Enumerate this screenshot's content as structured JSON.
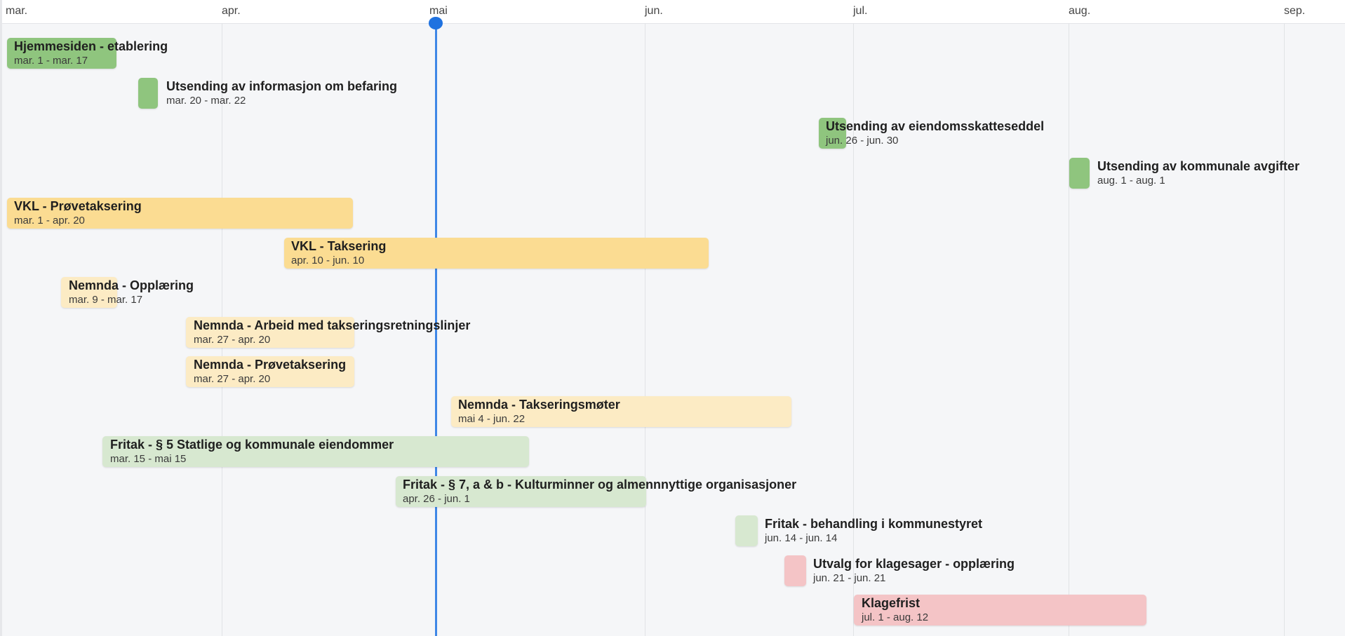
{
  "timeline": {
    "months": [
      "mar.",
      "apr.",
      "mai",
      "jun.",
      "jul.",
      "aug.",
      "sep."
    ],
    "today_marker_month": "mai",
    "tasks": [
      {
        "title": "Hjemmesiden - etablering",
        "dates": "mar. 1 - mar. 17",
        "color": "#8fc57e"
      },
      {
        "title": "Utsending av informasjon om befaring",
        "dates": "mar. 20 - mar. 22",
        "color": "#8fc57e"
      },
      {
        "title": "Utsending av eiendomsskatteseddel",
        "dates": "jun. 26 - jun. 30",
        "color": "#8fc57e"
      },
      {
        "title": "Utsending av kommunale avgifter",
        "dates": "aug. 1 - aug. 1",
        "color": "#8fc57e"
      },
      {
        "title": "VKL - Prøvetaksering",
        "dates": "mar. 1 - apr. 20",
        "color": "#fbdc92"
      },
      {
        "title": "VKL - Taksering",
        "dates": "apr. 10 - jun. 10",
        "color": "#fbdc92"
      },
      {
        "title": "Nemnda - Opplæring",
        "dates": "mar. 9 - mar. 17",
        "color": "#fcebc4"
      },
      {
        "title": "Nemnda - Arbeid med takseringsretningslinjer",
        "dates": "mar. 27 - apr. 20",
        "color": "#fcebc4"
      },
      {
        "title": "Nemnda - Prøvetaksering",
        "dates": "mar. 27 - apr. 20",
        "color": "#fcebc4"
      },
      {
        "title": "Nemnda - Takseringsmøter",
        "dates": "mai 4 - jun. 22",
        "color": "#fcebc4"
      },
      {
        "title": "Fritak - § 5 Statlige og kommunale eiendommer",
        "dates": "mar. 15 - mai 15",
        "color": "#d7e8d0"
      },
      {
        "title": "Fritak - § 7, a & b - Kulturminner og almennnyttige organisasjoner",
        "dates": "apr. 26 - jun. 1",
        "color": "#d7e8d0"
      },
      {
        "title": "Fritak - behandling i kommunestyret",
        "dates": "jun. 14 - jun. 14",
        "color": "#d7e8d0"
      },
      {
        "title": "Utvalg for klagesager - opplæring",
        "dates": "jun. 21 - jun. 21",
        "color": "#f4c4c6"
      },
      {
        "title": "Klagefrist",
        "dates": "jul. 1 - aug. 12",
        "color": "#f4c4c6"
      }
    ]
  }
}
